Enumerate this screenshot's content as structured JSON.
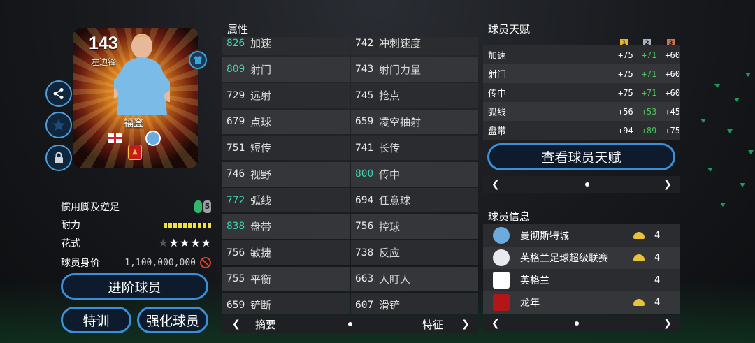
{
  "card": {
    "rating": "143",
    "position": "左边锋",
    "name": "福登"
  },
  "player_info": {
    "foot_label": "惯用脚及逆足",
    "weak_foot": "5",
    "stamina_label": "耐力",
    "stamina_segments": 10,
    "skill_label": "花式",
    "skill_stars": 4,
    "skill_stars_max": 5,
    "value_label": "球员身价",
    "value": "1,100,000,000"
  },
  "buttons": {
    "advance": "进阶球员",
    "train": "特训",
    "boost": "强化球员"
  },
  "attributes": {
    "title": "属性",
    "rows": [
      [
        {
          "v": "826",
          "n": "加速",
          "hi": true
        },
        {
          "v": "742",
          "n": "冲刺速度",
          "hi": false
        }
      ],
      [
        {
          "v": "809",
          "n": "射门",
          "hi": true
        },
        {
          "v": "743",
          "n": "射门力量",
          "hi": false
        }
      ],
      [
        {
          "v": "729",
          "n": "远射",
          "hi": false
        },
        {
          "v": "745",
          "n": "抢点",
          "hi": false
        }
      ],
      [
        {
          "v": "679",
          "n": "点球",
          "hi": false
        },
        {
          "v": "659",
          "n": "凌空抽射",
          "hi": false
        }
      ],
      [
        {
          "v": "751",
          "n": "短传",
          "hi": false
        },
        {
          "v": "741",
          "n": "长传",
          "hi": false
        }
      ],
      [
        {
          "v": "746",
          "n": "视野",
          "hi": false
        },
        {
          "v": "800",
          "n": "传中",
          "hi": true
        }
      ],
      [
        {
          "v": "772",
          "n": "弧线",
          "hi": true
        },
        {
          "v": "694",
          "n": "任意球",
          "hi": false
        }
      ],
      [
        {
          "v": "838",
          "n": "盘带",
          "hi": true
        },
        {
          "v": "756",
          "n": "控球",
          "hi": false
        }
      ],
      [
        {
          "v": "756",
          "n": "敏捷",
          "hi": false
        },
        {
          "v": "738",
          "n": "反应",
          "hi": false
        }
      ],
      [
        {
          "v": "755",
          "n": "平衡",
          "hi": false
        },
        {
          "v": "663",
          "n": "人盯人",
          "hi": false
        }
      ],
      [
        {
          "v": "659",
          "n": "铲断",
          "hi": false
        },
        {
          "v": "607",
          "n": "滑铲",
          "hi": false
        }
      ]
    ],
    "footer_left": "摘要",
    "footer_right": "特征"
  },
  "traits": {
    "title": "球员天赋",
    "tiers": [
      "1",
      "2",
      "3"
    ],
    "tier_colors": [
      "#e8b62a",
      "#a8b4c2",
      "#c9774a"
    ],
    "rows": [
      {
        "name": "加速",
        "t1": "+75",
        "t2": "+71",
        "t3": "+60"
      },
      {
        "name": "射门",
        "t1": "+75",
        "t2": "+71",
        "t3": "+60"
      },
      {
        "name": "传中",
        "t1": "+75",
        "t2": "+71",
        "t3": "+60"
      },
      {
        "name": "弧线",
        "t1": "+56",
        "t2": "+53",
        "t3": "+45"
      },
      {
        "name": "盘带",
        "t1": "+94",
        "t2": "+89",
        "t3": "+75"
      }
    ],
    "view_button": "查看球员天赋"
  },
  "info": {
    "title": "球员信息",
    "items": [
      {
        "name": "曼彻斯特城",
        "icon": "man-city-crest-icon",
        "chem": "4",
        "lamp": true
      },
      {
        "name": "英格兰足球超级联赛",
        "icon": "premier-league-icon",
        "chem": "4",
        "lamp": true
      },
      {
        "name": "英格兰",
        "icon": "england-flag-icon",
        "chem": "4",
        "lamp": false
      },
      {
        "name": "龙年",
        "icon": "dragon-year-icon",
        "chem": "4",
        "lamp": true
      }
    ]
  },
  "colors": {
    "accent_blue": "#3a8fd8",
    "highlight_teal": "#3fd3b0",
    "green_value": "#4cc35a",
    "stamina_yellow": "#f0e23a"
  }
}
